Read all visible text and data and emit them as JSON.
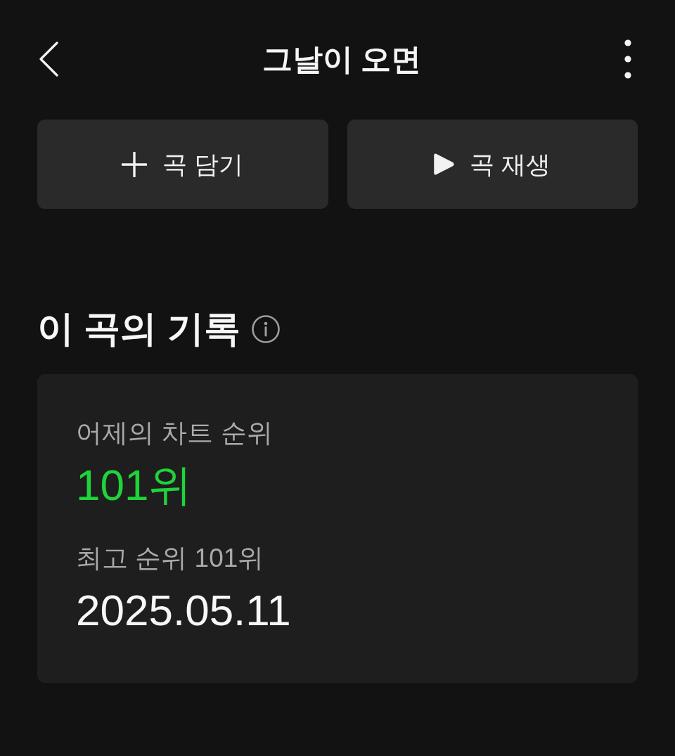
{
  "header": {
    "title": "그날이 오면"
  },
  "actions": [
    {
      "kind": "add",
      "label": "곡 담기"
    },
    {
      "kind": "play",
      "label": "곡 재생"
    }
  ],
  "record": {
    "title": "이 곡의 기록",
    "stats": [
      {
        "label": "어제의 차트 순위",
        "value": "101위",
        "highlight": true
      },
      {
        "label": "최고 순위 101위",
        "value": "2025.05.11",
        "highlight": false
      }
    ]
  }
}
